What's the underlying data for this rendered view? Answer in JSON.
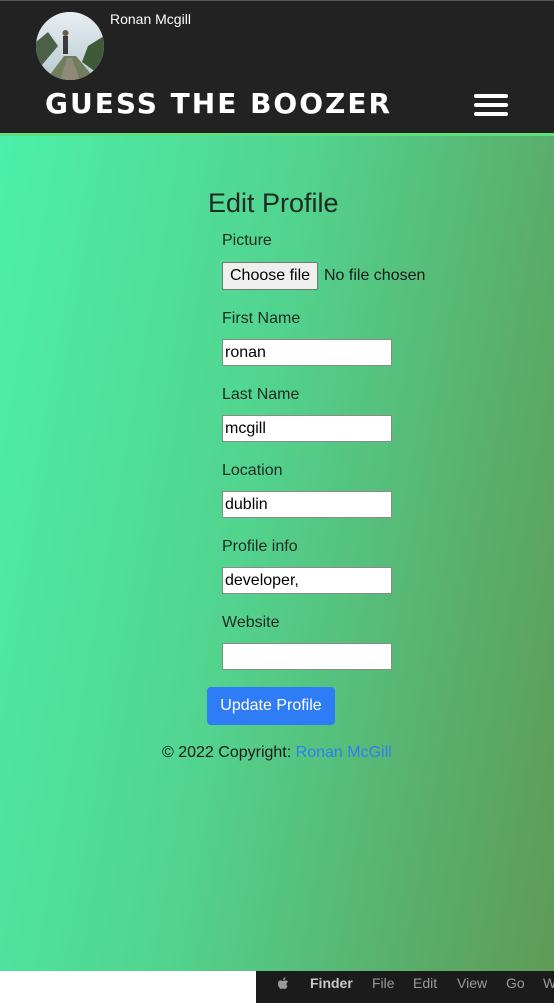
{
  "navbar": {
    "username": "Ronan Mcgill",
    "brand": "GUESS THE BOOZER",
    "menu_icon": "hamburger-menu-icon",
    "accent_color": "#5fe07a"
  },
  "form": {
    "title": "Edit Profile",
    "picture_label": "Picture",
    "file_button": "Choose file",
    "file_status": "No file chosen",
    "first_name_label": "First Name",
    "first_name_value": "ronan",
    "last_name_label": "Last Name",
    "last_name_value": "mcgill",
    "location_label": "Location",
    "location_value": "dublin",
    "profile_info_label": "Profile info",
    "profile_info_value": "developer,",
    "website_label": "Website",
    "website_value": "",
    "submit_label": "Update Profile",
    "submit_color": "#2f7df6"
  },
  "footer": {
    "copyright": "© 2022 Copyright: ",
    "author_link": "Ronan McGill"
  },
  "mac_menubar": {
    "apple_icon": "apple-icon",
    "items": [
      "Finder",
      "File",
      "Edit",
      "View",
      "Go",
      "W"
    ]
  }
}
